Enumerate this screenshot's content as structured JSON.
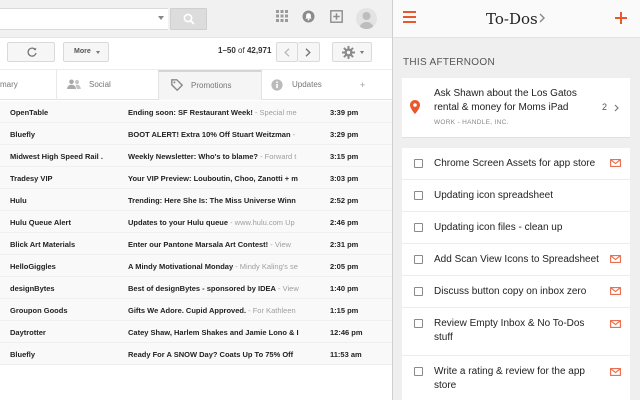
{
  "gmail": {
    "toolbar": {
      "more_label": "More",
      "paging_range": "1–50",
      "paging_of": "of",
      "paging_total": "42,971"
    },
    "tabs": [
      {
        "label": "mary",
        "icon": "inbox-icon"
      },
      {
        "label": "Social",
        "icon": "people-icon"
      },
      {
        "label": "Promotions",
        "icon": "tag-icon"
      },
      {
        "label": "Updates",
        "icon": "info-icon"
      },
      {
        "label": "+",
        "icon": "add-tab"
      }
    ],
    "emails": [
      {
        "sender": "OpenTable",
        "subject": "Ending soon: SF Restaurant Week!",
        "snippet": " - Special me",
        "time": "3:39 pm"
      },
      {
        "sender": "Bluefly",
        "subject": "BOOT ALERT! Extra 10% Off Stuart Weitzman",
        "snippet": " - ",
        "time": "3:29 pm"
      },
      {
        "sender": "Midwest High Speed Rail .",
        "subject": "Weekly Newsletter: Who's to blame?",
        "snippet": " - Forward t",
        "time": "3:15 pm"
      },
      {
        "sender": "Tradesy VIP",
        "subject": "Your VIP Preview: Louboutin, Choo, Zanotti + m",
        "snippet": "",
        "time": "3:03 pm"
      },
      {
        "sender": "Hulu",
        "subject": "Trending: Here She Is: The Miss Universe Winn",
        "snippet": "",
        "time": "2:52 pm"
      },
      {
        "sender": "Hulu Queue Alert",
        "subject": "Updates to your Hulu queue",
        "snippet": " - www.hulu.com Up",
        "time": "2:46 pm"
      },
      {
        "sender": "Blick Art Materials",
        "subject": "Enter our Pantone Marsala Art Contest!",
        "snippet": " - View",
        "time": "2:31 pm"
      },
      {
        "sender": "HelloGiggles",
        "subject": "A Mindy Motivational Monday",
        "snippet": " - Mindy Kaling's se",
        "time": "2:05 pm"
      },
      {
        "sender": "designBytes",
        "subject": "Best of designBytes - sponsored by IDEA",
        "snippet": " - View",
        "time": "1:40 pm"
      },
      {
        "sender": "Groupon Goods",
        "subject": "Gifts We Adore. Cupid Approved.",
        "snippet": " - For Kathleen",
        "time": "1:15 pm"
      },
      {
        "sender": "Daytrotter",
        "subject": "Catey Shaw, Harlem Shakes and Jamie Lono & I",
        "snippet": "",
        "time": "12:46 pm"
      },
      {
        "sender": "Bluefly",
        "subject": "Ready For A SNOW Day? Coats Up To 75% Off",
        "snippet": "",
        "time": "11:53 am"
      }
    ]
  },
  "todos": {
    "title": "To-Dos",
    "section": "THIS AFTERNOON",
    "main_item": {
      "text": "Ask Shawn about the Los Gatos rental & money for Moms iPad",
      "meta": "WORK - HANDLE, INC.",
      "count": "2"
    },
    "items": [
      {
        "text": "Chrome Screen Assets for app store",
        "has_mail": true
      },
      {
        "text": "Updating icon spreadsheet",
        "has_mail": false
      },
      {
        "text": "Updating icon files - clean up",
        "has_mail": false
      },
      {
        "text": "Add Scan View Icons to Spreadsheet",
        "has_mail": true
      },
      {
        "text": "Discuss button copy on inbox zero",
        "has_mail": true
      },
      {
        "text": "Review Empty Inbox & No To-Dos stuff",
        "has_mail": true
      },
      {
        "text": "Write a rating & review for the app store",
        "has_mail": true
      }
    ]
  },
  "colors": {
    "accent": "#e8582c",
    "mail_icon": "#e86a4a"
  }
}
